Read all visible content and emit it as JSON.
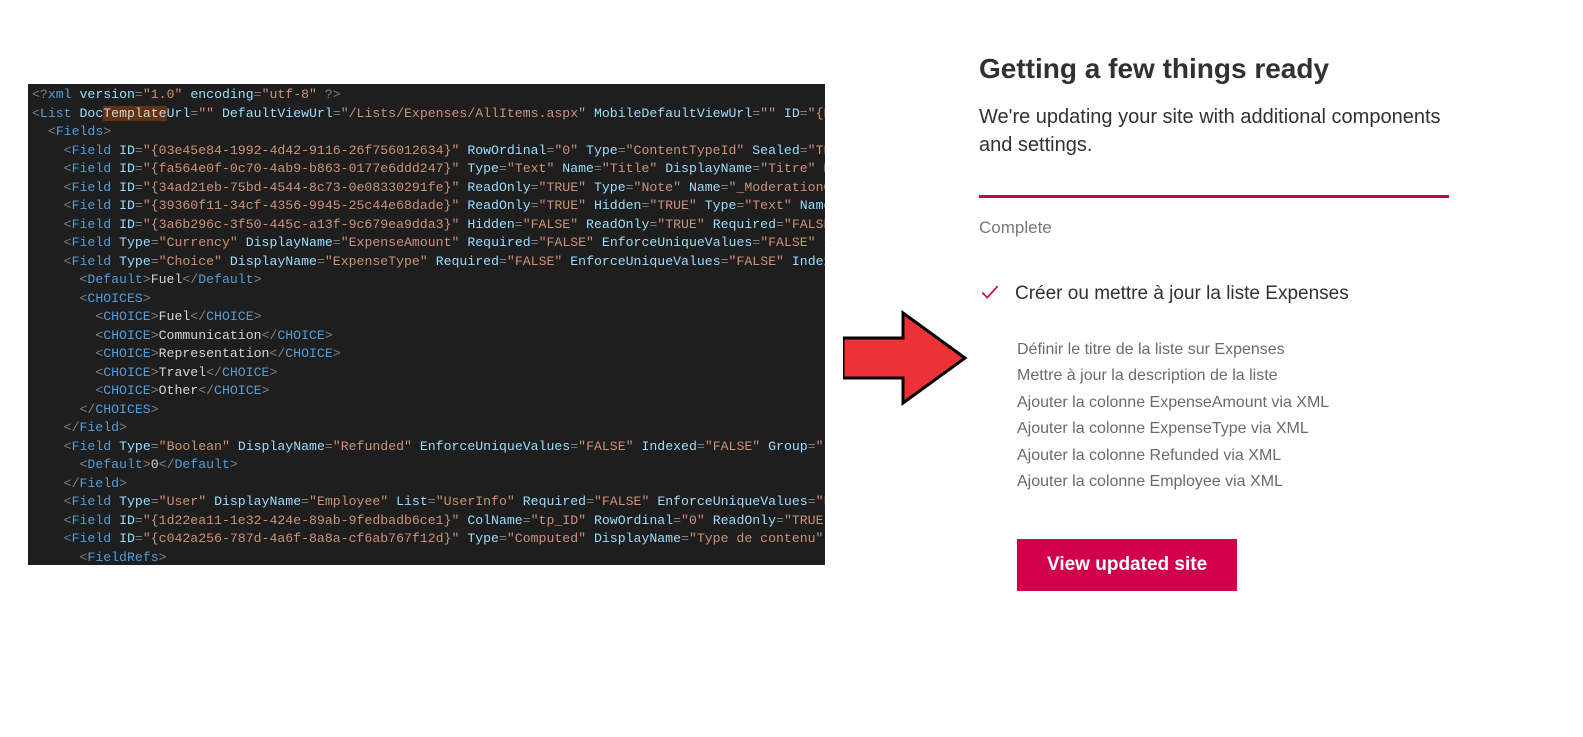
{
  "code": {
    "lines_html": [
      "<span class='p'>&lt;?</span><span class='t'>xml</span> <span class='a'>version</span><span class='p'>=</span><span class='s'>\"1.0\"</span> <span class='a'>encoding</span><span class='p'>=</span><span class='s'>\"utf-8\"</span> <span class='p'>?&gt;</span>",
      "<span class='p'>&lt;</span><span class='t'>List</span> <span class='a'>Doc</span><span class='hl'>Template</span><span class='a'>Url</span><span class='p'>=</span><span class='s'>\"\"</span> <span class='a'>DefaultViewUrl</span><span class='p'>=</span><span class='s'>\"/Lists/Expenses/AllItems.aspx\"</span> <span class='a'>MobileDefaultViewUrl</span><span class='p'>=</span><span class='s'>\"\"</span> <span class='a'>ID</span><span class='p'>=</span><span class='s'>\"{E</span>",
      "  <span class='p'>&lt;</span><span class='t'>Fields</span><span class='p'>&gt;</span>",
      "    <span class='p'>&lt;</span><span class='t'>Field</span> <span class='a'>ID</span><span class='p'>=</span><span class='s'>\"{03e45e84-1992-4d42-9116-26f756012634}\"</span> <span class='a'>RowOrdinal</span><span class='p'>=</span><span class='s'>\"0\"</span> <span class='a'>Type</span><span class='p'>=</span><span class='s'>\"ContentTypeId\"</span> <span class='a'>Sealed</span><span class='p'>=</span><span class='s'>\"TR</span>",
      "    <span class='p'>&lt;</span><span class='t'>Field</span> <span class='a'>ID</span><span class='p'>=</span><span class='s'>\"{fa564e0f-0c70-4ab9-b863-0177e6ddd247}\"</span> <span class='a'>Type</span><span class='p'>=</span><span class='s'>\"Text\"</span> <span class='a'>Name</span><span class='p'>=</span><span class='s'>\"Title\"</span> <span class='a'>DisplayName</span><span class='p'>=</span><span class='s'>\"Titre\"</span> <span class='a'>Re</span>",
      "    <span class='p'>&lt;</span><span class='t'>Field</span> <span class='a'>ID</span><span class='p'>=</span><span class='s'>\"{34ad21eb-75bd-4544-8c73-0e08330291fe}\"</span> <span class='a'>ReadOnly</span><span class='p'>=</span><span class='s'>\"TRUE\"</span> <span class='a'>Type</span><span class='p'>=</span><span class='s'>\"Note\"</span> <span class='a'>Name</span><span class='p'>=</span><span class='s'>\"_ModerationC</span>",
      "    <span class='p'>&lt;</span><span class='t'>Field</span> <span class='a'>ID</span><span class='p'>=</span><span class='s'>\"{39360f11-34cf-4356-9945-25c44e68dade}\"</span> <span class='a'>ReadOnly</span><span class='p'>=</span><span class='s'>\"TRUE\"</span> <span class='a'>Hidden</span><span class='p'>=</span><span class='s'>\"TRUE\"</span> <span class='a'>Type</span><span class='p'>=</span><span class='s'>\"Text\"</span> <span class='a'>Name</span>",
      "    <span class='p'>&lt;</span><span class='t'>Field</span> <span class='a'>ID</span><span class='p'>=</span><span class='s'>\"{3a6b296c-3f50-445c-a13f-9c679ea9dda3}\"</span> <span class='a'>Hidden</span><span class='p'>=</span><span class='s'>\"FALSE\"</span> <span class='a'>ReadOnly</span><span class='p'>=</span><span class='s'>\"TRUE\"</span> <span class='a'>Required</span><span class='p'>=</span><span class='s'>\"FALSE</span>",
      "    <span class='p'>&lt;</span><span class='t'>Field</span> <span class='a'>Type</span><span class='p'>=</span><span class='s'>\"Currency\"</span> <span class='a'>DisplayName</span><span class='p'>=</span><span class='s'>\"ExpenseAmount\"</span> <span class='a'>Required</span><span class='p'>=</span><span class='s'>\"FALSE\"</span> <span class='a'>EnforceUniqueValues</span><span class='p'>=</span><span class='s'>\"FALSE\"</span> <span class='a'>I</span>",
      "    <span class='p'>&lt;</span><span class='t'>Field</span> <span class='a'>Type</span><span class='p'>=</span><span class='s'>\"Choice\"</span> <span class='a'>DisplayName</span><span class='p'>=</span><span class='s'>\"ExpenseType\"</span> <span class='a'>Required</span><span class='p'>=</span><span class='s'>\"FALSE\"</span> <span class='a'>EnforceUniqueValues</span><span class='p'>=</span><span class='s'>\"FALSE\"</span> <span class='a'>Index</span>",
      "      <span class='p'>&lt;</span><span class='t'>Default</span><span class='p'>&gt;</span><span class='tx'>Fuel</span><span class='p'>&lt;/</span><span class='t'>Default</span><span class='p'>&gt;</span>",
      "      <span class='p'>&lt;</span><span class='t'>CHOICES</span><span class='p'>&gt;</span>",
      "        <span class='p'>&lt;</span><span class='t'>CHOICE</span><span class='p'>&gt;</span><span class='tx'>Fuel</span><span class='p'>&lt;/</span><span class='t'>CHOICE</span><span class='p'>&gt;</span>",
      "        <span class='p'>&lt;</span><span class='t'>CHOICE</span><span class='p'>&gt;</span><span class='tx'>Communication</span><span class='p'>&lt;/</span><span class='t'>CHOICE</span><span class='p'>&gt;</span>",
      "        <span class='p'>&lt;</span><span class='t'>CHOICE</span><span class='p'>&gt;</span><span class='tx'>Representation</span><span class='p'>&lt;/</span><span class='t'>CHOICE</span><span class='p'>&gt;</span>",
      "        <span class='p'>&lt;</span><span class='t'>CHOICE</span><span class='p'>&gt;</span><span class='tx'>Travel</span><span class='p'>&lt;/</span><span class='t'>CHOICE</span><span class='p'>&gt;</span>",
      "        <span class='p'>&lt;</span><span class='t'>CHOICE</span><span class='p'>&gt;</span><span class='tx'>Other</span><span class='p'>&lt;/</span><span class='t'>CHOICE</span><span class='p'>&gt;</span>",
      "      <span class='p'>&lt;/</span><span class='t'>CHOICES</span><span class='p'>&gt;</span>",
      "    <span class='p'>&lt;/</span><span class='t'>Field</span><span class='p'>&gt;</span>",
      "    <span class='p'>&lt;</span><span class='t'>Field</span> <span class='a'>Type</span><span class='p'>=</span><span class='s'>\"Boolean\"</span> <span class='a'>DisplayName</span><span class='p'>=</span><span class='s'>\"Refunded\"</span> <span class='a'>EnforceUniqueValues</span><span class='p'>=</span><span class='s'>\"FALSE\"</span> <span class='a'>Indexed</span><span class='p'>=</span><span class='s'>\"FALSE\"</span> <span class='a'>Group</span><span class='p'>=</span><span class='s'>\"</span>",
      "      <span class='p'>&lt;</span><span class='t'>Default</span><span class='p'>&gt;</span><span class='tx'>0</span><span class='p'>&lt;/</span><span class='t'>Default</span><span class='p'>&gt;</span>",
      "    <span class='p'>&lt;/</span><span class='t'>Field</span><span class='p'>&gt;</span>",
      "    <span class='p'>&lt;</span><span class='t'>Field</span> <span class='a'>Type</span><span class='p'>=</span><span class='s'>\"User\"</span> <span class='a'>DisplayName</span><span class='p'>=</span><span class='s'>\"Employee\"</span> <span class='a'>List</span><span class='p'>=</span><span class='s'>\"UserInfo\"</span> <span class='a'>Required</span><span class='p'>=</span><span class='s'>\"FALSE\"</span> <span class='a'>EnforceUniqueValues</span><span class='p'>=</span><span class='s'>\"F</span>",
      "    <span class='p'>&lt;</span><span class='t'>Field</span> <span class='a'>ID</span><span class='p'>=</span><span class='s'>\"{1d22ea11-1e32-424e-89ab-9fedbadb6ce1}\"</span> <span class='a'>ColName</span><span class='p'>=</span><span class='s'>\"tp_ID\"</span> <span class='a'>RowOrdinal</span><span class='p'>=</span><span class='s'>\"0\"</span> <span class='a'>ReadOnly</span><span class='p'>=</span><span class='s'>\"TRUE\"</span>",
      "    <span class='p'>&lt;</span><span class='t'>Field</span> <span class='a'>ID</span><span class='p'>=</span><span class='s'>\"{c042a256-787d-4a6f-8a8a-cf6ab767f12d}\"</span> <span class='a'>Type</span><span class='p'>=</span><span class='s'>\"Computed\"</span> <span class='a'>DisplayName</span><span class='p'>=</span><span class='s'>\"Type de contenu\"</span> ",
      "      <span class='p'>&lt;</span><span class='t'>FieldRefs</span><span class='p'>&gt;</span>"
    ]
  },
  "panel": {
    "heading": "Getting a few things ready",
    "subtext": "We're updating your site with additional components and settings.",
    "status": "Complete",
    "task_title": "Créer ou mettre à jour la liste Expenses",
    "sub_items": [
      "Définir le titre de la liste sur Expenses",
      "Mettre à jour la description de la liste",
      "Ajouter la colonne ExpenseAmount via XML",
      "Ajouter la colonne ExpenseType via XML",
      "Ajouter la colonne Refunded via XML",
      "Ajouter la colonne Employee via XML"
    ],
    "button_label": "View updated site"
  }
}
